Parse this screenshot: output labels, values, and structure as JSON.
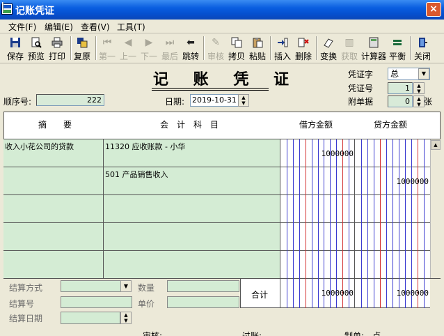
{
  "window": {
    "title": "记账凭证",
    "close_label": "×"
  },
  "menu": [
    "文件(F)",
    "编辑(E)",
    "查看(V)",
    "工具(T)"
  ],
  "toolbar": {
    "save": "保存",
    "preview": "预览",
    "print": "打印",
    "restore": "复原",
    "first": "第一",
    "prev": "上一",
    "next": "下一",
    "last": "最后",
    "jump": "跳转",
    "audit": "审核",
    "copy": "拷贝",
    "paste": "粘贴",
    "insert": "插入",
    "delete": "删除",
    "convert": "变换",
    "fetch": "获取",
    "calculator": "计算器",
    "balance": "平衡",
    "close": "关闭"
  },
  "header": {
    "title": "记 账 凭 证",
    "voucher_type_label": "凭证字",
    "voucher_type_value": "总",
    "voucher_no_label": "凭证号",
    "voucher_no_value": "1",
    "attachments_label": "附单据",
    "attachments_value": "0",
    "attachments_unit": "张",
    "seq_label": "顺序号:",
    "seq_value": "222",
    "date_label": "日期:",
    "date_value": "2019-10-31"
  },
  "grid": {
    "columns": [
      "摘　　要",
      "会　计　科　目",
      "借方金额",
      "贷方金额"
    ],
    "rows": [
      {
        "summary": "收入小花公司的贷款",
        "account": "11320 应收账款 - 小华",
        "debit": "1000000",
        "credit": ""
      },
      {
        "summary": "",
        "account": "501 产品销售收入",
        "debit": "",
        "credit": "1000000"
      },
      {
        "summary": "",
        "account": "",
        "debit": "",
        "credit": ""
      },
      {
        "summary": "",
        "account": "",
        "debit": "",
        "credit": ""
      },
      {
        "summary": "",
        "account": "",
        "debit": "",
        "credit": ""
      }
    ],
    "total_label": "合计",
    "total_debit": "1000000",
    "total_credit": "1000000"
  },
  "settlement": {
    "method_label": "结算方式",
    "qty_label": "数量",
    "number_label": "结算号",
    "price_label": "单价",
    "date_label": "结算日期"
  },
  "footer": {
    "auditor_label": "审核:",
    "poster_label": "过账:",
    "maker_label": "制单:",
    "maker_value": "卢"
  }
}
